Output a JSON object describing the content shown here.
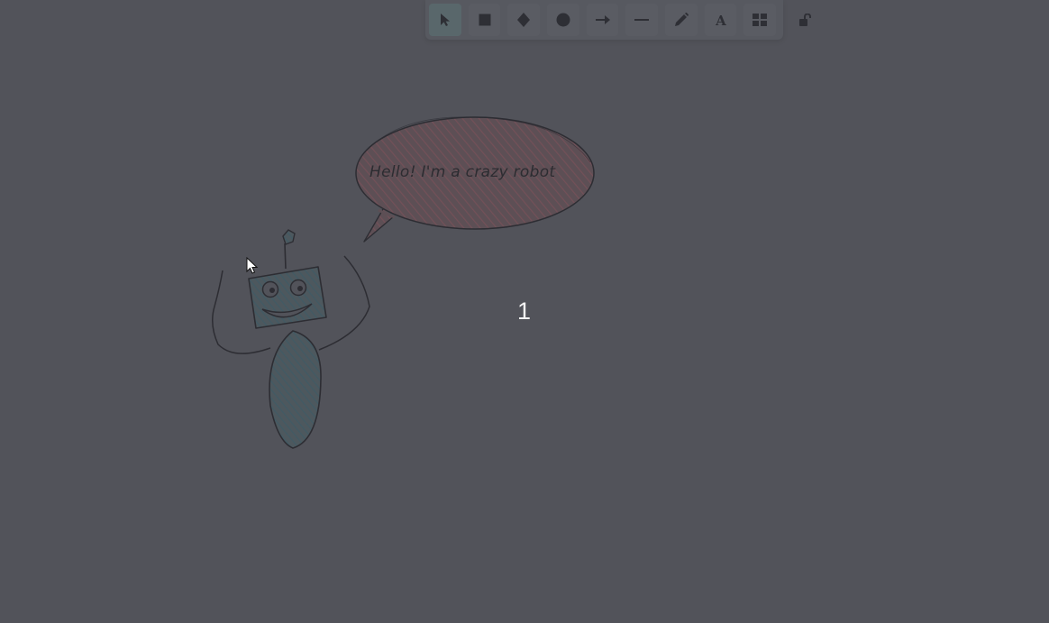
{
  "toolbar": {
    "tools": [
      {
        "name": "selection",
        "icon": "pointer-icon",
        "active": true
      },
      {
        "name": "rectangle",
        "icon": "square-icon",
        "active": false
      },
      {
        "name": "diamond",
        "icon": "diamond-icon",
        "active": false
      },
      {
        "name": "ellipse",
        "icon": "circle-icon",
        "active": false
      },
      {
        "name": "arrow",
        "icon": "arrow-icon",
        "active": false
      },
      {
        "name": "line",
        "icon": "line-icon",
        "active": false
      },
      {
        "name": "draw",
        "icon": "pencil-icon",
        "active": false
      },
      {
        "name": "text",
        "icon": "text-icon",
        "active": false
      },
      {
        "name": "library",
        "icon": "grid-icon",
        "active": false
      }
    ],
    "text_tool_glyph": "A",
    "lock": {
      "icon": "lock-open-icon"
    }
  },
  "canvas": {
    "speech_bubble_text": "Hello! I'm a crazy robot",
    "step_number": "1",
    "bubble_fill": "#6a4f56",
    "robot_fill": "#495a62",
    "stroke_color": "#2d2d33",
    "background": "#52535a"
  }
}
